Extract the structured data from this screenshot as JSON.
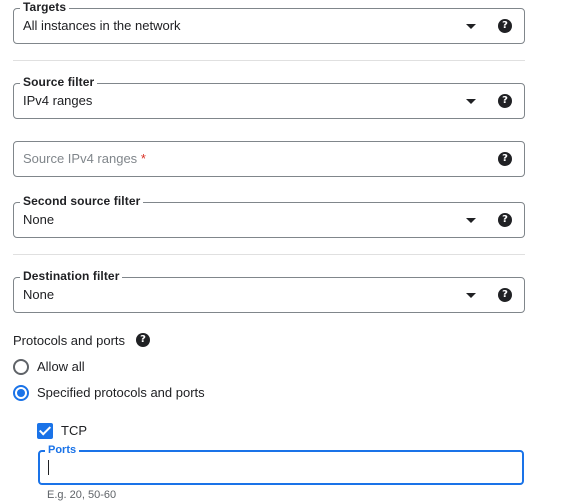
{
  "targets": {
    "label": "Targets",
    "value": "All instances in the network",
    "help_icon": "help-icon"
  },
  "source_filter": {
    "label": "Source filter",
    "value": "IPv4 ranges",
    "help_icon": "help-icon"
  },
  "source_ipv4_ranges": {
    "placeholder": "Source IPv4 ranges",
    "required_marker": "*",
    "help_icon": "help-icon"
  },
  "second_source_filter": {
    "label": "Second source filter",
    "value": "None",
    "help_icon": "help-icon"
  },
  "destination_filter": {
    "label": "Destination filter",
    "value": "None",
    "help_icon": "help-icon"
  },
  "protocols_and_ports": {
    "title": "Protocols and ports",
    "help_icon": "help-icon",
    "options": [
      {
        "label": "Allow all",
        "selected": false
      },
      {
        "label": "Specified protocols and ports",
        "selected": true
      }
    ],
    "tcp": {
      "label": "TCP",
      "checked": true
    },
    "ports": {
      "label": "Ports",
      "value": "",
      "hint": "E.g. 20, 50-60"
    }
  },
  "colors": {
    "accent": "#1a73e8",
    "required": "#d93025",
    "border": "#80868b",
    "text": "#202124"
  }
}
